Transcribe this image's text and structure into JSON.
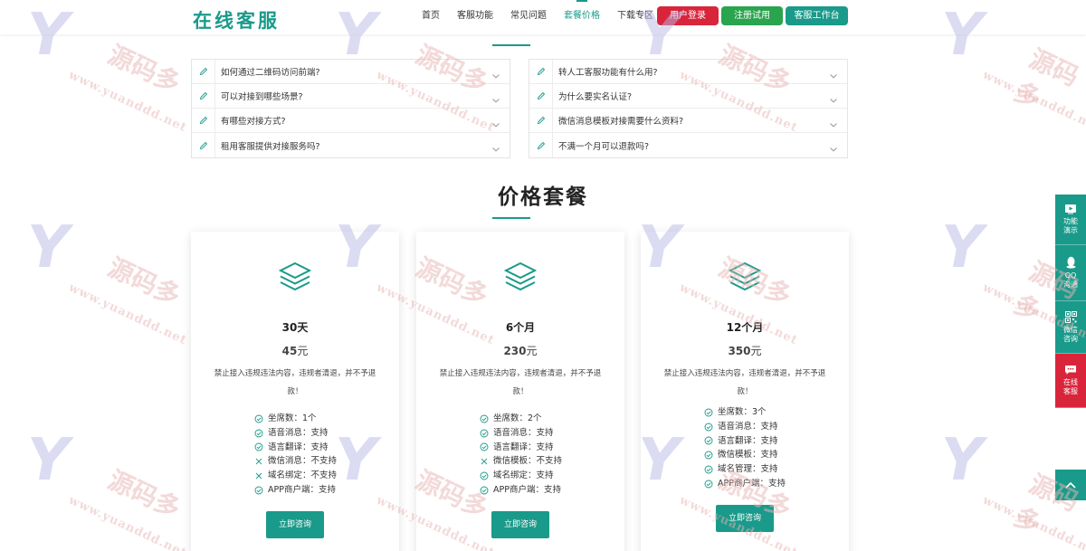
{
  "header": {
    "logo": "在线客服",
    "nav": [
      {
        "label": "首页",
        "active": false
      },
      {
        "label": "客服功能",
        "active": false
      },
      {
        "label": "常见问题",
        "active": false
      },
      {
        "label": "套餐价格",
        "active": true
      },
      {
        "label": "下载专区",
        "active": false
      }
    ],
    "buttons": {
      "login": "用户登录",
      "trial": "注册试用",
      "desk": "客服工作台"
    }
  },
  "faq": {
    "left": [
      "如何通过二维码访问前端?",
      "可以对接到哪些场景?",
      "有哪些对接方式?",
      "租用客服提供对接服务吗?"
    ],
    "right": [
      "转人工客服功能有什么用?",
      "为什么要实名认证?",
      "微信消息模板对接需要什么资料?",
      "不满一个月可以退款吗?"
    ]
  },
  "pricing": {
    "title": "价格套餐",
    "plans": [
      {
        "duration": "30天",
        "price_num": "45",
        "price_unit": "元",
        "note": "禁止接入违规违法内容，违规者清退，并不予退款！",
        "features": [
          {
            "text": "坐席数：1个",
            "ok": true
          },
          {
            "text": "语音消息：支持",
            "ok": true
          },
          {
            "text": "语言翻译：支持",
            "ok": true
          },
          {
            "text": "微信消息：不支持",
            "ok": false
          },
          {
            "text": "域名绑定：不支持",
            "ok": false
          },
          {
            "text": "APP商户端：支持",
            "ok": true
          }
        ],
        "button": "立即咨询"
      },
      {
        "duration": "6个月",
        "price_num": "230",
        "price_unit": "元",
        "note": "禁止接入违规违法内容，违规者清退，并不予退款！",
        "features": [
          {
            "text": "坐席数：2个",
            "ok": true
          },
          {
            "text": "语音消息：支持",
            "ok": true
          },
          {
            "text": "语言翻译：支持",
            "ok": true
          },
          {
            "text": "微信模板：不支持",
            "ok": false
          },
          {
            "text": "域名绑定：支持",
            "ok": true
          },
          {
            "text": "APP商户端：支持",
            "ok": true
          }
        ],
        "button": "立即咨询"
      },
      {
        "duration": "12个月",
        "price_num": "350",
        "price_unit": "元",
        "note": "禁止接入违规违法内容，违规者清退，并不予退款！",
        "features": [
          {
            "text": "坐席数：3个",
            "ok": true
          },
          {
            "text": "语音消息：支持",
            "ok": true
          },
          {
            "text": "语言翻译：支持",
            "ok": true
          },
          {
            "text": "微信模板：支持",
            "ok": true
          },
          {
            "text": "域名管理：支持",
            "ok": true
          },
          {
            "text": "APP商户端：支持",
            "ok": true
          }
        ],
        "button": "立即咨询"
      }
    ]
  },
  "float_bar": [
    {
      "label": "功能\n演示",
      "icon": "video-icon"
    },
    {
      "label": "QQ\n沟通",
      "icon": "qq-icon"
    },
    {
      "label": "微信\n咨询",
      "icon": "qrcode-icon"
    },
    {
      "label": "在线\n客服",
      "icon": "chat-icon"
    }
  ],
  "watermark": {
    "brand": "源码多",
    "url": "www.yuanddd.net"
  },
  "colors": {
    "accent": "#1a9a8a",
    "red": "#d9253b",
    "green": "#2aa44e"
  }
}
